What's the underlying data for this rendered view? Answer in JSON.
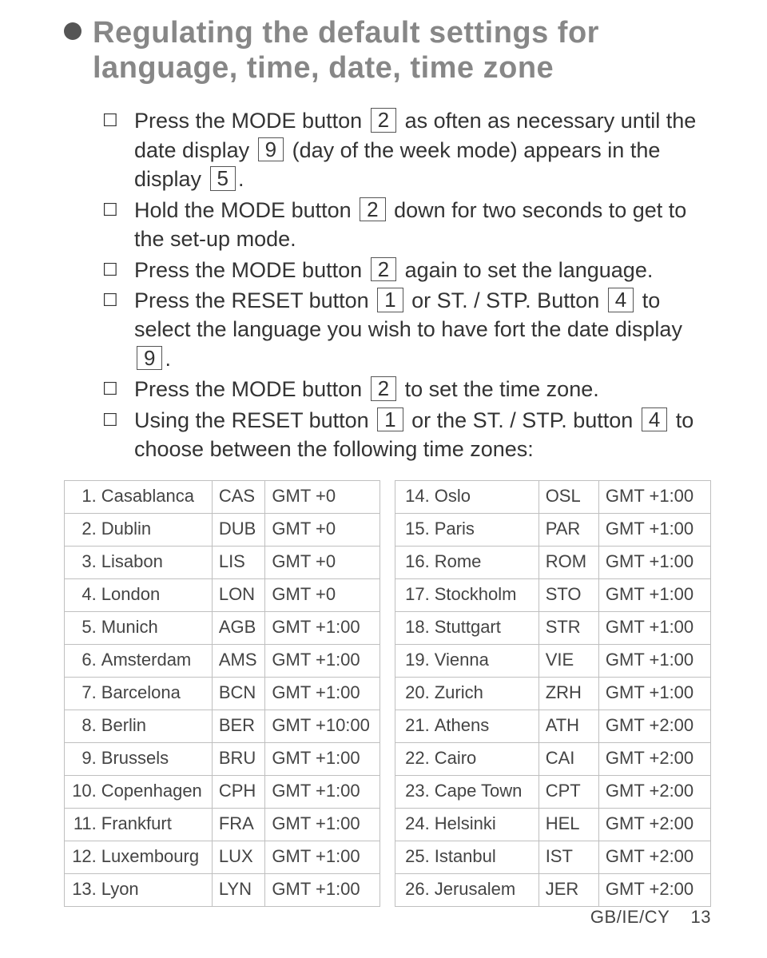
{
  "heading": "Regulating the default settings for language, time, date, time zone",
  "instructions": [
    {
      "pre": "Press the MODE button ",
      "k1": "2",
      "mid1": " as often as necessary until the date display ",
      "k2": "9",
      "mid2": " (day of the week mode) appears in the display ",
      "k3": "5",
      "post": "."
    },
    {
      "pre": "Hold the MODE button ",
      "k1": "2",
      "mid1": " down for two seconds to get to the set-up mode.",
      "k2": "",
      "mid2": "",
      "k3": "",
      "post": ""
    },
    {
      "pre": "Press the MODE button ",
      "k1": "2",
      "mid1": " again to set the language.",
      "k2": "",
      "mid2": "",
      "k3": "",
      "post": ""
    },
    {
      "pre": "Press the RESET button ",
      "k1": "1",
      "mid1": " or ST. / STP. Button ",
      "k2": "4",
      "mid2": " to select the language you wish to have fort the date display ",
      "k3": "9",
      "post": "."
    },
    {
      "pre": "Press the MODE button ",
      "k1": "2",
      "mid1": " to set the time zone.",
      "k2": "",
      "mid2": "",
      "k3": "",
      "post": ""
    },
    {
      "pre": "Using the RESET button ",
      "k1": "1",
      "mid1": " or the ST. / STP. button ",
      "k2": "4",
      "mid2": " to choose between the following time zones:",
      "k3": "",
      "post": ""
    }
  ],
  "table_left": [
    {
      "n": "1.",
      "city": "Casablanca",
      "code": "CAS",
      "gmt": "GMT +0"
    },
    {
      "n": "2.",
      "city": "Dublin",
      "code": "DUB",
      "gmt": "GMT +0"
    },
    {
      "n": "3.",
      "city": "Lisabon",
      "code": "LIS",
      "gmt": "GMT +0"
    },
    {
      "n": "4.",
      "city": "London",
      "code": "LON",
      "gmt": "GMT +0"
    },
    {
      "n": "5.",
      "city": "Munich",
      "code": "AGB",
      "gmt": "GMT +1:00"
    },
    {
      "n": "6.",
      "city": "Amsterdam",
      "code": "AMS",
      "gmt": "GMT +1:00"
    },
    {
      "n": "7.",
      "city": "Barcelona",
      "code": "BCN",
      "gmt": "GMT +1:00"
    },
    {
      "n": "8.",
      "city": "Berlin",
      "code": "BER",
      "gmt": "GMT +10:00"
    },
    {
      "n": "9.",
      "city": "Brussels",
      "code": "BRU",
      "gmt": "GMT +1:00"
    },
    {
      "n": "10.",
      "city": "Copenhagen",
      "code": "CPH",
      "gmt": "GMT +1:00"
    },
    {
      "n": "11.",
      "city": "Frankfurt",
      "code": "FRA",
      "gmt": "GMT +1:00"
    },
    {
      "n": "12.",
      "city": "Luxembourg",
      "code": "LUX",
      "gmt": "GMT +1:00"
    },
    {
      "n": "13.",
      "city": "Lyon",
      "code": "LYN",
      "gmt": "GMT +1:00"
    }
  ],
  "table_right": [
    {
      "n": "14.",
      "city": "Oslo",
      "code": "OSL",
      "gmt": "GMT +1:00"
    },
    {
      "n": "15.",
      "city": "Paris",
      "code": "PAR",
      "gmt": "GMT +1:00"
    },
    {
      "n": "16.",
      "city": "Rome",
      "code": "ROM",
      "gmt": "GMT +1:00"
    },
    {
      "n": "17.",
      "city": "Stockholm",
      "code": "STO",
      "gmt": "GMT +1:00"
    },
    {
      "n": "18.",
      "city": "Stuttgart",
      "code": "STR",
      "gmt": "GMT +1:00"
    },
    {
      "n": "19.",
      "city": "Vienna",
      "code": "VIE",
      "gmt": "GMT +1:00"
    },
    {
      "n": "20.",
      "city": "Zurich",
      "code": "ZRH",
      "gmt": "GMT +1:00"
    },
    {
      "n": "21.",
      "city": "Athens",
      "code": "ATH",
      "gmt": "GMT +2:00"
    },
    {
      "n": "22.",
      "city": "Cairo",
      "code": "CAI",
      "gmt": "GMT +2:00"
    },
    {
      "n": "23.",
      "city": "Cape Town",
      "code": "CPT",
      "gmt": "GMT +2:00"
    },
    {
      "n": "24.",
      "city": "Helsinki",
      "code": "HEL",
      "gmt": "GMT +2:00"
    },
    {
      "n": "25.",
      "city": "Istanbul",
      "code": "IST",
      "gmt": "GMT +2:00"
    },
    {
      "n": "26.",
      "city": "Jerusalem",
      "code": "JER",
      "gmt": "GMT +2:00"
    }
  ],
  "footer_label": "GB/IE/CY",
  "footer_page": "13"
}
